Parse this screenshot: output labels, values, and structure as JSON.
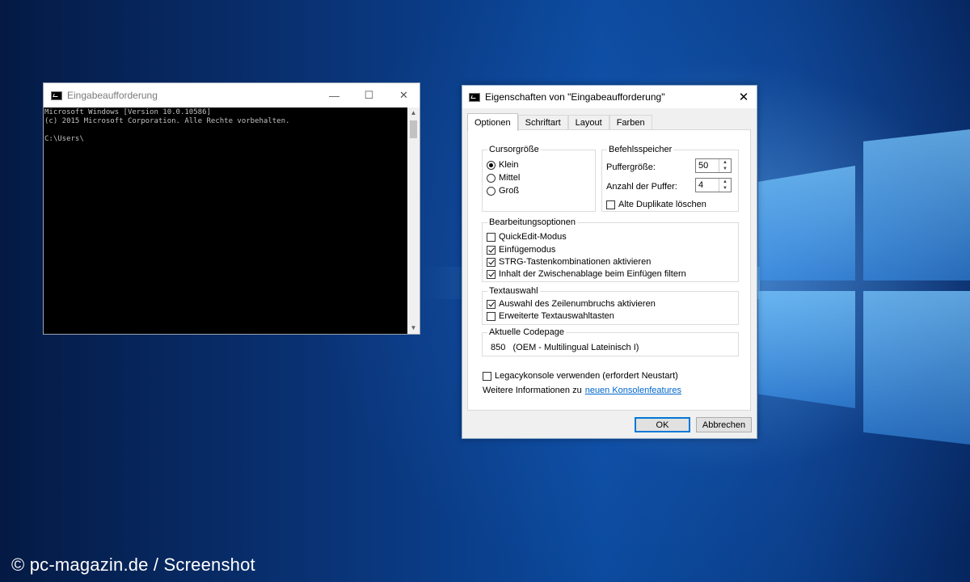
{
  "watermark": "© pc-magazin.de / Screenshot",
  "console": {
    "title": "Eingabeaufforderung",
    "lines": [
      "Microsoft Windows [Version 10.0.10586]",
      "(c) 2015 Microsoft Corporation. Alle Rechte vorbehalten.",
      "",
      "C:\\Users\\"
    ],
    "controls": {
      "minimize": "—",
      "maximize": "☐",
      "close": "✕"
    }
  },
  "dialog": {
    "title": "Eigenschaften von \"Eingabeaufforderung\"",
    "close": "✕",
    "tabs": [
      "Optionen",
      "Schriftart",
      "Layout",
      "Farben"
    ],
    "active_tab": "Optionen",
    "cursor_group": {
      "label": "Cursorgröße",
      "options": [
        {
          "label": "Klein",
          "checked": true
        },
        {
          "label": "Mittel",
          "checked": false
        },
        {
          "label": "Groß",
          "checked": false
        }
      ]
    },
    "history_group": {
      "label": "Befehlsspeicher",
      "buffer_size_label": "Puffergröße:",
      "buffer_size_value": "50",
      "buffer_count_label": "Anzahl der Puffer:",
      "buffer_count_value": "4",
      "discard_duplicates_label": "Alte Duplikate löschen",
      "discard_duplicates_checked": false
    },
    "edit_group": {
      "label": "Bearbeitungsoptionen",
      "options": [
        {
          "label": "QuickEdit-Modus",
          "checked": false
        },
        {
          "label": "Einfügemodus",
          "checked": true
        },
        {
          "label": "STRG-Tastenkombinationen aktivieren",
          "checked": true
        },
        {
          "label": "Inhalt der Zwischenablage beim Einfügen filtern",
          "checked": true
        }
      ]
    },
    "text_group": {
      "label": "Textauswahl",
      "options": [
        {
          "label": "Auswahl des Zeilenumbruchs aktivieren",
          "checked": true
        },
        {
          "label": "Erweiterte Textauswahltasten",
          "checked": false
        }
      ]
    },
    "codepage_group": {
      "label": "Aktuelle Codepage",
      "value": "850   (OEM - Multilingual Lateinisch I)"
    },
    "legacy_label": "Legacykonsole verwenden (erfordert Neustart)",
    "legacy_checked": false,
    "info_text": "Weitere Informationen zu",
    "info_link": "neuen Konsolenfeatures",
    "ok_label": "OK",
    "cancel_label": "Abbrechen",
    "accent_color": "#0078d7"
  }
}
